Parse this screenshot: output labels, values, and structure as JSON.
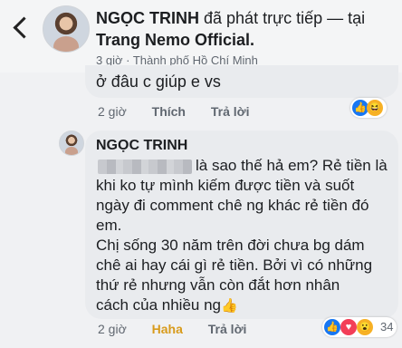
{
  "post_header": {
    "page_name": "NGỌC TRINH",
    "action_text": "đã phát trực tiếp — tại",
    "location_name": "Trang Nemo Official.",
    "time": "3 giờ",
    "place": "Thành phố Hồ Chí Minh"
  },
  "previous_comment": {
    "text": "ở đâu c giúp e vs",
    "time": "2 giờ",
    "like_label": "Thích",
    "reply_label": "Trả lời",
    "reaction_icons": [
      "like-icon",
      "haha-icon"
    ]
  },
  "reply_comment": {
    "author": "NGỌC TRINH",
    "lines": [
      "là sao thế hả em? Rẻ tiền là",
      "khi ko tự mình kiếm được tiền và suốt",
      "ngày đi comment chê ng khác rẻ tiền đó",
      "em.",
      "Chị sống 30 năm trên đời chưa bg dám",
      "chê ai hay cái gì rẻ tiền. Bởi vì có những",
      "thứ rẻ nhưng vẫn còn đắt hơn nhân",
      "cách của nhiều ng"
    ],
    "thumb_emoji": "👍",
    "time": "2 giờ",
    "reaction_label": "Haha",
    "reply_label": "Trả lời",
    "reaction_icons": [
      "like-icon",
      "love-icon",
      "wow-icon"
    ],
    "reaction_count": "34"
  },
  "colors": {
    "accent": "#1877f2",
    "haha": "#d89b1c",
    "bubble": "#e9ebee"
  }
}
